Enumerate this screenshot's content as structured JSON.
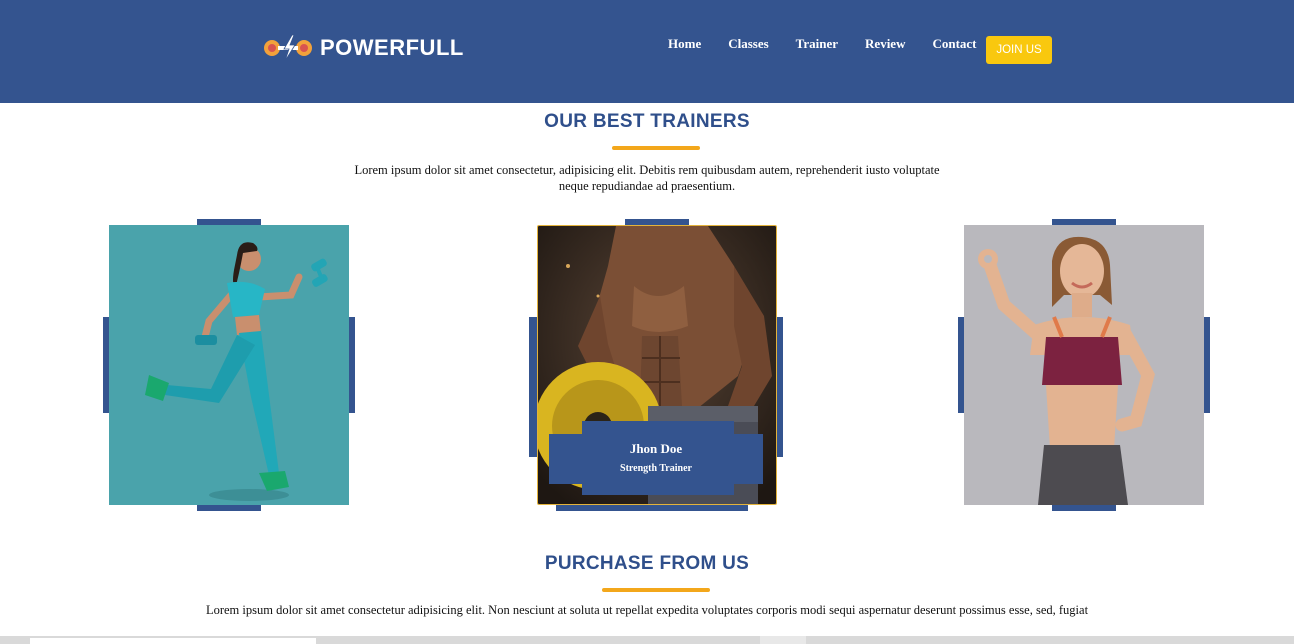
{
  "header": {
    "brand": "POWERFULL",
    "logo_icon": "dumbbell-lightning-icon",
    "nav": [
      {
        "label": "Home"
      },
      {
        "label": "Classes"
      },
      {
        "label": "Trainer"
      },
      {
        "label": "Review"
      },
      {
        "label": "Contact"
      }
    ],
    "join_label": "JOIN US"
  },
  "colors": {
    "primary": "#34548f",
    "accent": "#f3a71b",
    "button": "#f9c80e"
  },
  "trainers_section": {
    "title": "OUR BEST TRAINERS",
    "description_line1": "Lorem ipsum dolor sit amet consectetur, adipisicing elit. Debitis rem quibusdam autem, reprehenderit iusto voluptate",
    "description_line2": "neque repudiandae ad praesentium.",
    "trainers": [
      {
        "photo": "woman-running-dumbbells-photo"
      },
      {
        "photo": "muscular-man-weight-plate-photo",
        "name": "Jhon Doe",
        "role": "Strength Trainer"
      },
      {
        "photo": "woman-ok-sign-photo"
      }
    ]
  },
  "purchase_section": {
    "title": "PURCHASE FROM US",
    "description": "Lorem ipsum dolor sit amet consectetur adipisicing elit. Non nesciunt at soluta ut repellat expedita voluptates corporis modi sequi aspernatur deserunt possimus esse, sed, fugiat"
  }
}
